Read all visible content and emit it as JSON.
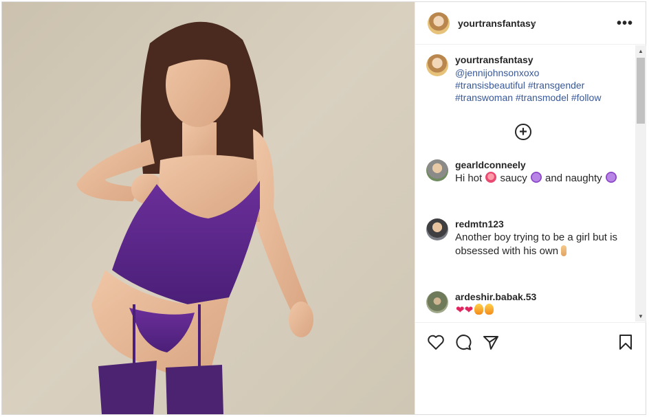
{
  "post": {
    "author": "yourtransfantasy",
    "separator": "•",
    "more_label": "•••"
  },
  "caption": {
    "user": "yourtransfantasy",
    "lines": [
      "@jennijohnsonxoxo",
      "#transisbeautiful #transgender",
      "#transwoman #transmodel #follow"
    ],
    "load_more_label": "+"
  },
  "comments": [
    {
      "user": "gearldconneely",
      "segments": [
        {
          "type": "text",
          "value": "Hi hot "
        },
        {
          "type": "emoji",
          "name": "hot-face"
        },
        {
          "type": "text",
          "value": " saucy "
        },
        {
          "type": "emoji",
          "name": "smiling-devil"
        },
        {
          "type": "text",
          "value": " and naughty "
        },
        {
          "type": "emoji",
          "name": "smiling-devil"
        }
      ]
    },
    {
      "user": "redmtn123",
      "segments": [
        {
          "type": "text",
          "value": "Another boy trying to be a girl but is obsessed with his own"
        },
        {
          "type": "emoji",
          "name": "middle-finger"
        }
      ]
    },
    {
      "user": "ardeshir.babak.53",
      "segments": [
        {
          "type": "text",
          "value": "❤❤"
        },
        {
          "type": "emoji",
          "name": "fire"
        },
        {
          "type": "emoji",
          "name": "fire"
        }
      ]
    }
  ],
  "icons": {
    "like": "heart-icon",
    "comment": "comment-bubble-icon",
    "share": "paper-plane-icon",
    "save": "bookmark-icon",
    "more": "ellipsis-icon",
    "load_more": "plus-circle-icon"
  },
  "colors": {
    "hashtag": "#385898",
    "text": "#262626",
    "border": "#efefef",
    "lingerie": "#5a2a86"
  }
}
